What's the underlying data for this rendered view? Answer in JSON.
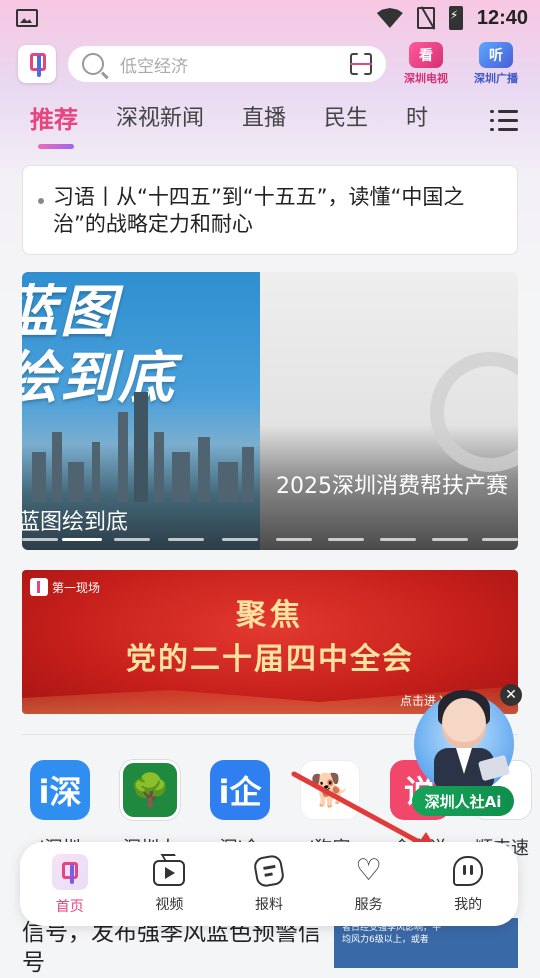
{
  "status_bar": {
    "time": "12:40"
  },
  "header": {
    "search_placeholder": "低空经济",
    "tv_button": {
      "icon_text": "看",
      "label": "深圳电视"
    },
    "radio_button": {
      "icon_text": "听",
      "label": "深圳广播"
    }
  },
  "tabs": [
    {
      "label": "推荐",
      "active": true
    },
    {
      "label": "深视新闻",
      "active": false
    },
    {
      "label": "直播",
      "active": false
    },
    {
      "label": "民生",
      "active": false
    },
    {
      "label": "时",
      "active": false
    }
  ],
  "headline": "习语丨从“十四五”到“十五五”，读懂“中国之治”的战略定力和耐心",
  "carousel": {
    "slide1": {
      "art_text": "蓝图\n绘到底",
      "caption": "蓝图绘到底"
    },
    "slide2": {
      "caption": "2025深圳消费帮扶产赛"
    }
  },
  "banner": {
    "tag": "第一现场",
    "title_line1": "聚焦",
    "title_line2": "党的二十届四中全会",
    "more": "点击进入专题"
  },
  "apps": [
    {
      "label": "i深圳",
      "icon_text": "i深",
      "color": "#2f8ef0"
    },
    {
      "label": "深圳人",
      "icon_text": "🌳",
      "color": "#1f8a3f"
    },
    {
      "label": "深i企",
      "icon_text": "i企",
      "color": "#2f7ff0"
    },
    {
      "label": "i狗家",
      "icon_text": "🐕",
      "color": "#f6a33a"
    },
    {
      "label": "食安说",
      "icon_text": "说",
      "color": "#f0476a"
    },
    {
      "label": "顺丰速",
      "icon_text": "",
      "color": "#ffffff"
    }
  ],
  "assistant": {
    "label": "深圳人社Ai",
    "close": "✕"
  },
  "below": {
    "text": "信号，发布强季风蓝色预警信号",
    "thumb_text": "者日经受强季风影响，平均风力6级以上，或者"
  },
  "bottom_nav": [
    {
      "label": "首页",
      "icon": "home-icon",
      "active": true
    },
    {
      "label": "视频",
      "icon": "video-icon",
      "active": false
    },
    {
      "label": "报料",
      "icon": "report-icon",
      "active": false
    },
    {
      "label": "服务",
      "icon": "heart-icon",
      "active": false
    },
    {
      "label": "我的",
      "icon": "mine-icon",
      "active": false
    }
  ],
  "colors": {
    "accent": "#e6457e",
    "assistant_green": "#17a35a",
    "banner_red": "#c8201c"
  }
}
